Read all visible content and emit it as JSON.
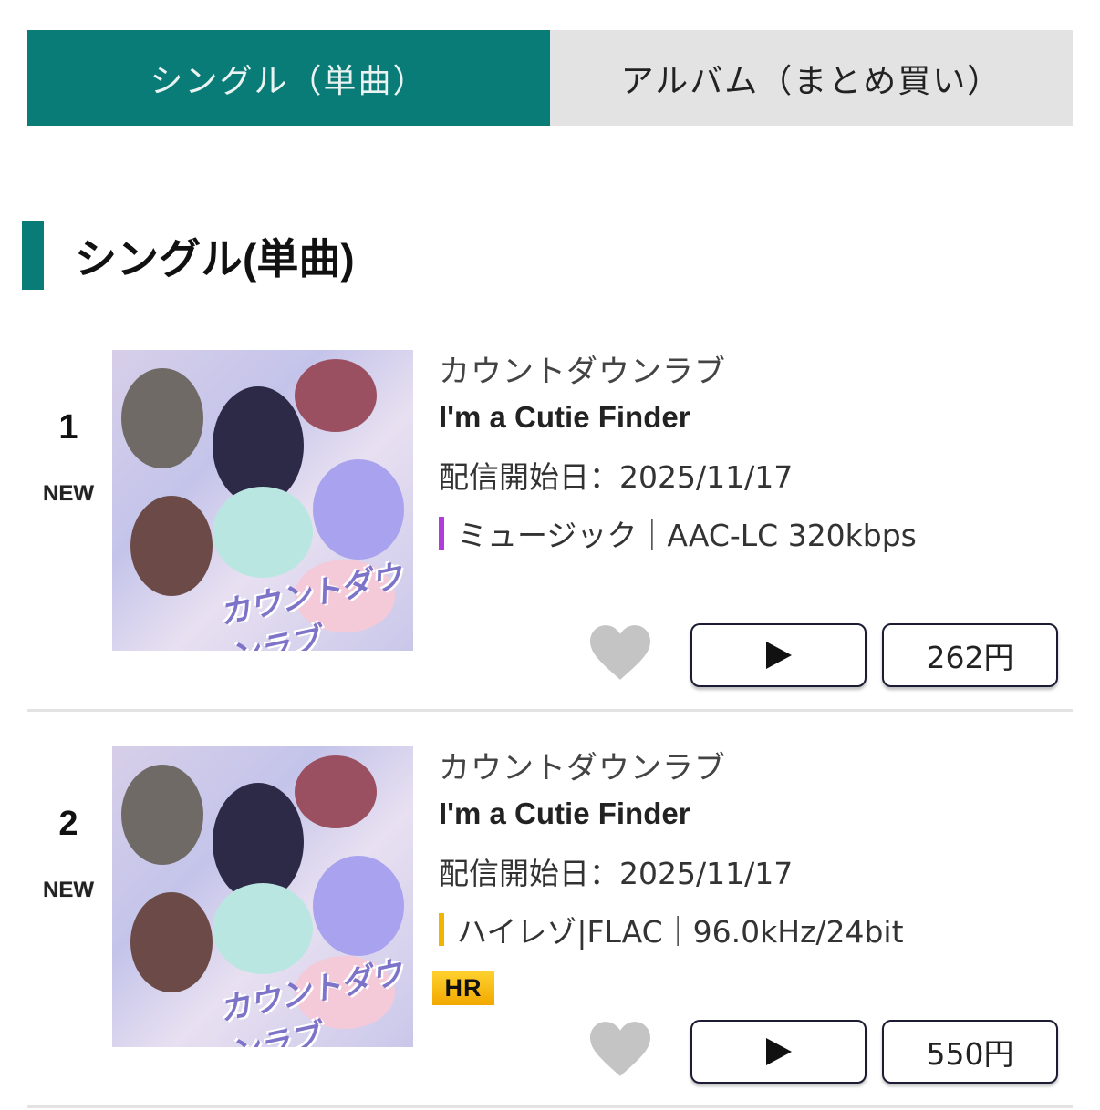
{
  "tabs": [
    {
      "label": "シングル（単曲）",
      "active": true
    },
    {
      "label": "アルバム（まとめ買い）",
      "active": false
    }
  ],
  "section": {
    "title": "シングル(単曲)"
  },
  "accent_color": "#0a7c78",
  "items": [
    {
      "rank": "1",
      "badge": "NEW",
      "cover_text": "カウントダウンラブ",
      "artist": "カウントダウンラブ",
      "title": "I'm a Cutie Finder",
      "date": "配信開始日：2025/11/17",
      "format": "ミュージック｜AAC-LC 320kbps",
      "format_color": "#b23bdc",
      "price": "262円",
      "hr": null
    },
    {
      "rank": "2",
      "badge": "NEW",
      "cover_text": "カウントダウンラブ",
      "artist": "カウントダウンラブ",
      "title": "I'm a Cutie Finder",
      "date": "配信開始日：2025/11/17",
      "format": "ハイレゾ|FLAC｜96.0kHz/24bit",
      "format_color": "#f2b400",
      "price": "550円",
      "hr": "HR"
    }
  ]
}
